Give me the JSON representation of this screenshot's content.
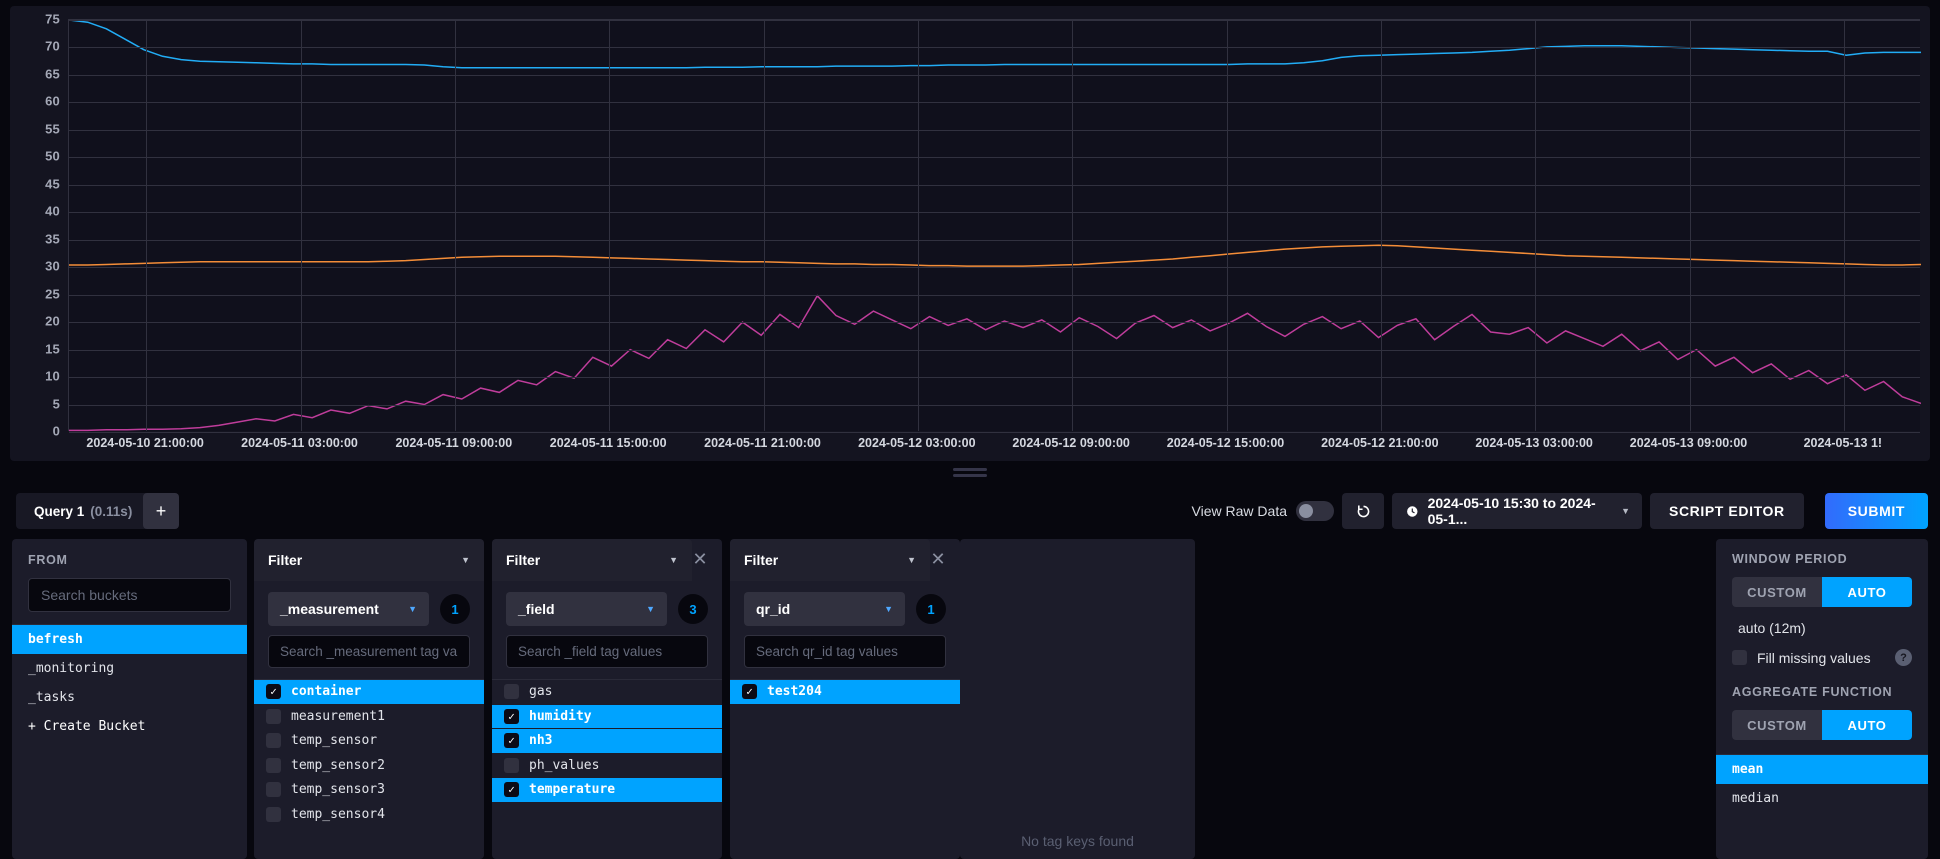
{
  "chart_data": {
    "type": "line",
    "title": "",
    "xlabel": "",
    "ylabel": "",
    "ylim": [
      0,
      75
    ],
    "ytick_step": 5,
    "yticks": [
      75,
      70,
      65,
      60,
      55,
      50,
      45,
      40,
      35,
      30,
      25,
      20,
      15,
      10,
      5,
      0
    ],
    "xticks": [
      "2024-05-10 21:00:00",
      "2024-05-11 03:00:00",
      "2024-05-11 09:00:00",
      "2024-05-11 15:00:00",
      "2024-05-11 21:00:00",
      "2024-05-12 03:00:00",
      "2024-05-12 09:00:00",
      "2024-05-12 15:00:00",
      "2024-05-12 21:00:00",
      "2024-05-13 03:00:00",
      "2024-05-13 09:00:00",
      "2024-05-13 1!"
    ],
    "grid": true,
    "legend": "none",
    "series": [
      {
        "name": "humidity",
        "color": "#22adf6",
        "values": [
          75,
          74.6,
          73.4,
          71.5,
          69.6,
          68.4,
          67.8,
          67.5,
          67.4,
          67.3,
          67.2,
          67.1,
          67.0,
          67.0,
          66.9,
          66.9,
          66.9,
          66.9,
          66.9,
          66.8,
          66.5,
          66.3,
          66.3,
          66.3,
          66.3,
          66.3,
          66.3,
          66.3,
          66.3,
          66.3,
          66.3,
          66.3,
          66.3,
          66.3,
          66.4,
          66.4,
          66.4,
          66.5,
          66.5,
          66.5,
          66.5,
          66.6,
          66.6,
          66.6,
          66.6,
          66.7,
          66.7,
          66.8,
          66.8,
          66.8,
          66.9,
          66.9,
          66.9,
          66.9,
          66.9,
          66.9,
          66.9,
          66.9,
          66.9,
          66.9,
          66.9,
          66.9,
          66.9,
          67.0,
          67.0,
          67.0,
          67.2,
          67.6,
          68.2,
          68.5,
          68.6,
          68.7,
          68.8,
          68.9,
          69.0,
          69.1,
          69.3,
          69.5,
          69.8,
          70.1,
          70.2,
          70.3,
          70.3,
          70.3,
          70.2,
          70.1,
          70.0,
          69.9,
          69.8,
          69.7,
          69.6,
          69.5,
          69.4,
          69.3,
          69.3,
          68.6,
          69.0,
          69.1,
          69.1,
          69.1
        ]
      },
      {
        "name": "temperature",
        "color": "#f48d38",
        "values": [
          30.4,
          30.4,
          30.5,
          30.6,
          30.7,
          30.8,
          30.9,
          31.0,
          31.0,
          31.0,
          31.0,
          31.0,
          31.0,
          31.0,
          31.0,
          31.0,
          31.0,
          31.1,
          31.2,
          31.4,
          31.6,
          31.8,
          31.9,
          32.0,
          32.0,
          32.0,
          32.0,
          31.9,
          31.8,
          31.7,
          31.6,
          31.5,
          31.4,
          31.3,
          31.2,
          31.1,
          31.0,
          31.0,
          30.9,
          30.8,
          30.7,
          30.6,
          30.6,
          30.5,
          30.5,
          30.4,
          30.3,
          30.3,
          30.2,
          30.2,
          30.2,
          30.2,
          30.3,
          30.4,
          30.5,
          30.7,
          30.9,
          31.1,
          31.3,
          31.5,
          31.8,
          32.1,
          32.4,
          32.7,
          33.0,
          33.3,
          33.5,
          33.7,
          33.8,
          33.9,
          34.0,
          33.9,
          33.7,
          33.5,
          33.3,
          33.1,
          32.9,
          32.7,
          32.5,
          32.3,
          32.1,
          32.0,
          31.9,
          31.8,
          31.7,
          31.6,
          31.5,
          31.4,
          31.3,
          31.2,
          31.1,
          31.0,
          30.9,
          30.8,
          30.7,
          30.6,
          30.5,
          30.4,
          30.4,
          30.5
        ]
      },
      {
        "name": "nh3",
        "color": "#bf3d9b",
        "values": [
          0.3,
          0.3,
          0.4,
          0.4,
          0.5,
          0.5,
          0.6,
          0.8,
          1.2,
          1.8,
          2.4,
          2.0,
          3.2,
          2.6,
          4.0,
          3.4,
          4.8,
          4.2,
          5.6,
          5.0,
          6.8,
          6.0,
          8.0,
          7.2,
          9.4,
          8.6,
          11.0,
          9.8,
          13.6,
          12.0,
          15.0,
          13.4,
          16.8,
          15.2,
          18.6,
          16.4,
          20.0,
          17.6,
          21.4,
          19.0,
          24.8,
          21.2,
          19.6,
          22.0,
          20.4,
          18.8,
          21.0,
          19.4,
          20.6,
          18.6,
          20.2,
          19.0,
          20.4,
          18.2,
          20.8,
          19.2,
          17.0,
          19.8,
          21.2,
          19.0,
          20.4,
          18.4,
          19.8,
          21.6,
          19.2,
          17.4,
          19.6,
          21.0,
          18.8,
          20.2,
          17.2,
          19.4,
          20.6,
          16.8,
          19.2,
          21.4,
          18.2,
          17.8,
          19.0,
          16.2,
          18.4,
          17.0,
          15.6,
          17.8,
          14.8,
          16.4,
          13.2,
          15.0,
          12.0,
          13.6,
          10.8,
          12.4,
          9.6,
          11.2,
          8.8,
          10.4,
          7.6,
          9.2,
          6.4,
          5.2
        ]
      }
    ]
  },
  "toolbar": {
    "query_tab_label": "Query 1",
    "query_tab_time": "(0.11s)",
    "add_query_label": "+",
    "view_raw_label": "View Raw Data",
    "view_raw_state": "off",
    "refresh_icon": "refresh-icon",
    "time_range_value": "2024-05-10 15:30 to 2024-05-1...",
    "clock_icon": "clock-icon",
    "script_editor_label": "SCRIPT EDITOR",
    "submit_label": "SUBMIT",
    "accent_color": "#00a3ff"
  },
  "from_panel": {
    "title": "FROM",
    "search_placeholder": "Search buckets",
    "buckets": [
      {
        "label": "befresh",
        "selected": true
      },
      {
        "label": "_monitoring",
        "selected": false
      },
      {
        "label": "_tasks",
        "selected": false
      }
    ],
    "create_bucket_label": "+ Create Bucket"
  },
  "filters": [
    {
      "header": "Filter",
      "key": "_measurement",
      "badge": "1",
      "search_placeholder": "Search _measurement tag va",
      "closable": false,
      "values": [
        {
          "label": "container",
          "checked": true
        },
        {
          "label": "measurement1",
          "checked": false
        },
        {
          "label": "temp_sensor",
          "checked": false
        },
        {
          "label": "temp_sensor2",
          "checked": false
        },
        {
          "label": "temp_sensor3",
          "checked": false
        },
        {
          "label": "temp_sensor4",
          "checked": false
        }
      ]
    },
    {
      "header": "Filter",
      "key": "_field",
      "badge": "3",
      "search_placeholder": "Search _field tag values",
      "closable": true,
      "values": [
        {
          "label": "gas",
          "checked": false
        },
        {
          "label": "humidity",
          "checked": true
        },
        {
          "label": "nh3",
          "checked": true
        },
        {
          "label": "ph_values",
          "checked": false
        },
        {
          "label": "temperature",
          "checked": true
        }
      ]
    },
    {
      "header": "Filter",
      "key": "qr_id",
      "badge": "1",
      "search_placeholder": "Search qr_id tag values",
      "closable": true,
      "values": [
        {
          "label": "test204",
          "checked": true
        }
      ]
    }
  ],
  "empty_panel": {
    "message": "No tag keys found"
  },
  "options_panel": {
    "window_period_label": "WINDOW PERIOD",
    "window_custom_label": "CUSTOM",
    "window_auto_label": "AUTO",
    "window_active": "AUTO",
    "auto_value": "auto (12m)",
    "fill_missing_label": "Fill missing values",
    "fill_missing_checked": false,
    "help_icon_label": "?",
    "aggregate_label": "AGGREGATE FUNCTION",
    "agg_custom_label": "CUSTOM",
    "agg_auto_label": "AUTO",
    "agg_active": "AUTO",
    "functions": [
      {
        "label": "mean",
        "selected": true
      },
      {
        "label": "median",
        "selected": false
      }
    ]
  }
}
